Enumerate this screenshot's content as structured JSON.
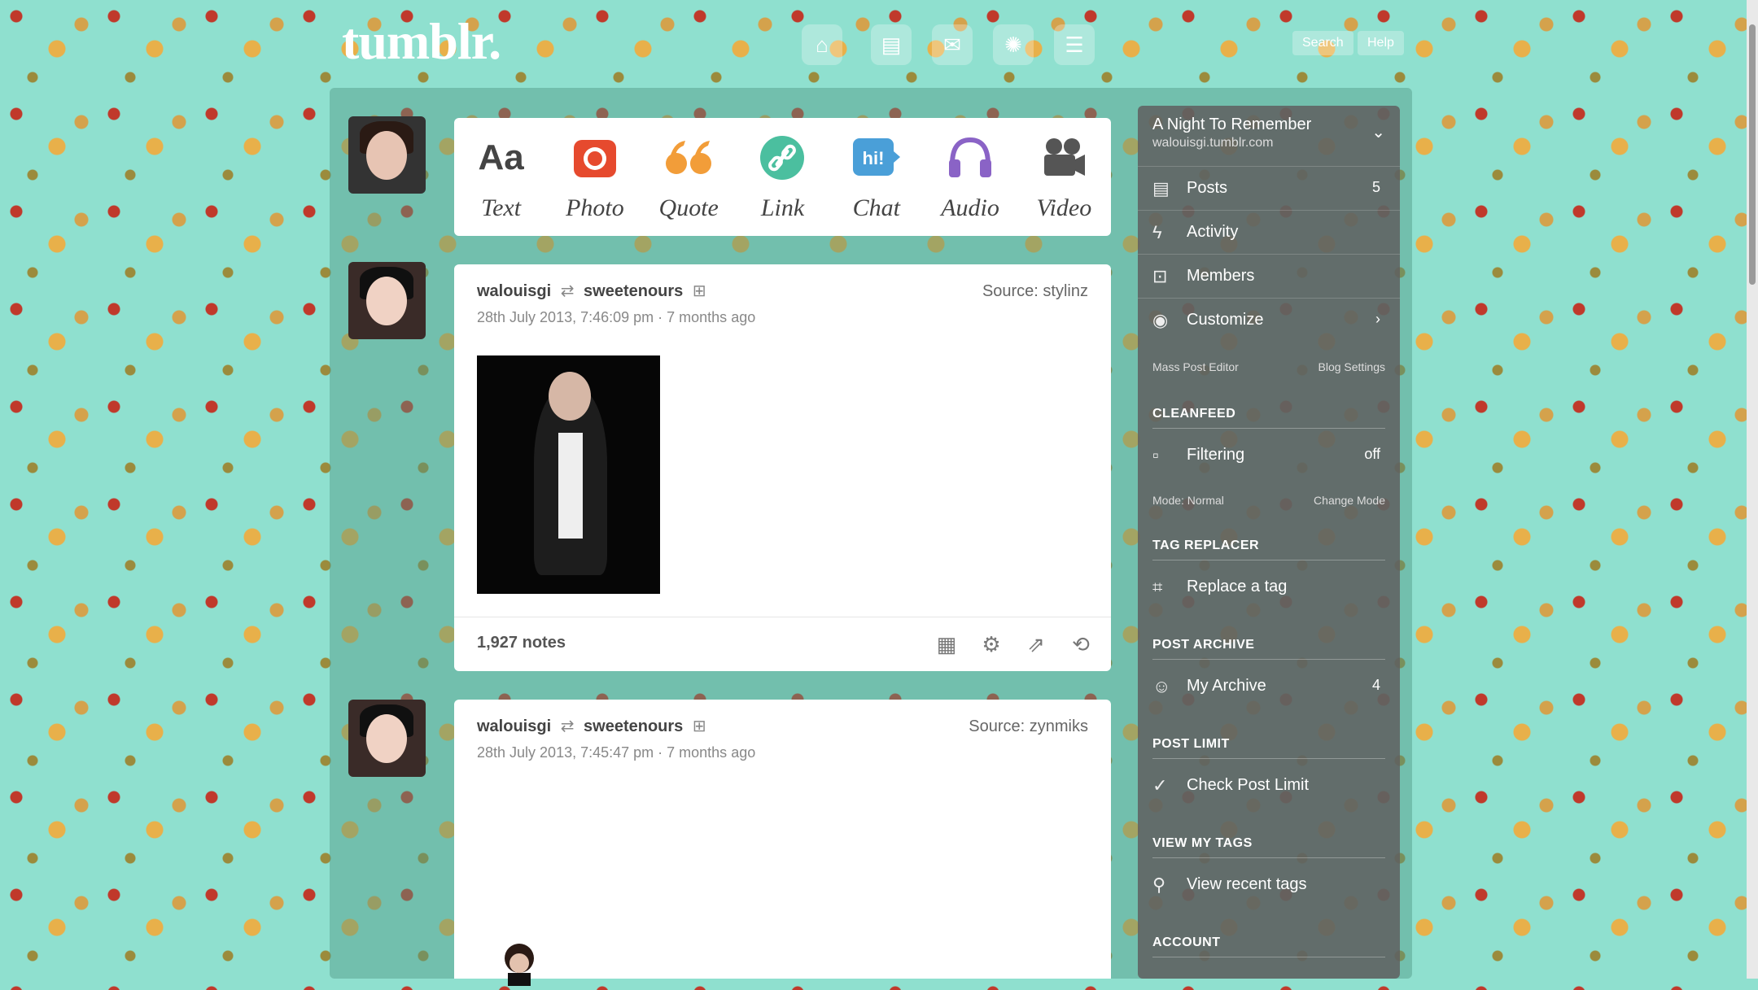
{
  "app": {
    "logo": "tumblr."
  },
  "topbar": {
    "icons": [
      "home-icon",
      "inbox-icon",
      "mail-icon",
      "compass-icon",
      "account-icon"
    ],
    "buttons": [
      "Search",
      "Help"
    ]
  },
  "post_types": [
    {
      "label": "Text",
      "glyph": "Aa",
      "color": "#444444"
    },
    {
      "label": "Photo",
      "glyph": "◉",
      "color": "#e64a2e"
    },
    {
      "label": "Quote",
      "glyph": "❝",
      "color": "#f29d39"
    },
    {
      "label": "Link",
      "glyph": "∞",
      "color": "#4bbf9f"
    },
    {
      "label": "Chat",
      "glyph": "hi!",
      "color": "#4a9fd8"
    },
    {
      "label": "Audio",
      "glyph": "♫",
      "color": "#8a63c6"
    },
    {
      "label": "Video",
      "glyph": "▶",
      "color": "#666666"
    }
  ],
  "posts": [
    {
      "author": "walouisgi",
      "reblogged_from": "sweetenours",
      "source": "Source: stylinz",
      "date": "28th July 2013, 7:46:09 pm · 7 months ago",
      "notes": "1,927 notes"
    },
    {
      "author": "walouisgi",
      "reblogged_from": "sweetenours",
      "source": "Source: zynmiks",
      "date": "28th July 2013, 7:45:47 pm · 7 months ago"
    }
  ],
  "sidebar": {
    "blog_title": "A Night To Remember",
    "blog_url": "walouisgi.tumblr.com",
    "items": [
      {
        "label": "Posts",
        "value": "5"
      },
      {
        "label": "Activity",
        "value": ""
      },
      {
        "label": "Members",
        "value": ""
      },
      {
        "label": "Customize",
        "value": ""
      }
    ],
    "links": {
      "left": "Mass Post Editor",
      "right": "Blog Settings"
    },
    "sections": {
      "cleanfeed": {
        "title": "CLEANFEED",
        "item": "Filtering",
        "value": "off",
        "sub_left": "Mode: Normal",
        "sub_right": "Change Mode"
      },
      "tag_replacer": {
        "title": "TAG REPLACER",
        "item": "Replace a tag"
      },
      "post_archive": {
        "title": "POST ARCHIVE",
        "item": "My Archive",
        "value": "4"
      },
      "post_limit": {
        "title": "POST LIMIT",
        "item": "Check Post Limit"
      },
      "view_my_tags": {
        "title": "VIEW MY TAGS",
        "item": "View recent tags"
      },
      "account": {
        "title": "ACCOUNT"
      }
    }
  }
}
